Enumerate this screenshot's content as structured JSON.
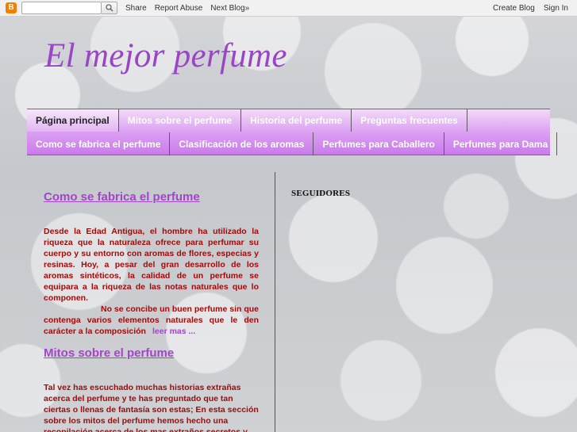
{
  "navbar": {
    "share": "Share",
    "report_abuse": "Report Abuse",
    "next_blog": "Next Blog»",
    "create_blog": "Create Blog",
    "sign_in": "Sign In",
    "search_placeholder": ""
  },
  "header": {
    "title": "El mejor perfume"
  },
  "tabs": {
    "row1": [
      {
        "label": "Página principal",
        "active": true
      },
      {
        "label": "Mitos sobre el perfume",
        "active": false
      },
      {
        "label": "Historia del perfume",
        "active": false
      },
      {
        "label": "Preguntas frecuentes",
        "active": false
      }
    ],
    "row2": [
      {
        "label": "Como se fabrica el perfume"
      },
      {
        "label": "Clasificación de los aromas"
      },
      {
        "label": "Perfumes para Caballero"
      },
      {
        "label": "Perfumes para Dama"
      }
    ]
  },
  "posts": [
    {
      "title": "Como se fabrica el perfume",
      "body_1": "Desde la Edad Antigua, el hombre ha utilizado la riqueza que la naturaleza ofrece para perfumar su cuerpo y su entorno con aromas de flores, especias y resinas. Hoy, a pesar del gran desarrollo de los aromas sintéticos, la calidad de un perfume se equipara a la riqueza de las notas naturales que lo componen.",
      "body_2": "No se concibe un buen perfume sin que contenga varios elementos naturales que le den carácter a la composición",
      "read_more": "leer mas ..."
    },
    {
      "title": "Mitos sobre el perfume",
      "body_1": "Tal vez has escuchado  muchas historias extrañas acerca del perfume y te has preguntado que tan ciertas o llenas de fantasía son estas; En esta sección sobre los mitos del perfume hemos hecho una recopilación acerca de los mas extraños secretos y mentiras que se"
    }
  ],
  "sidebar": {
    "followers_title": "SEGUIDORES"
  },
  "colors": {
    "accent_purple": "#a345c8",
    "body_red": "#a00c0c",
    "blogger_orange": "#f57d00"
  }
}
